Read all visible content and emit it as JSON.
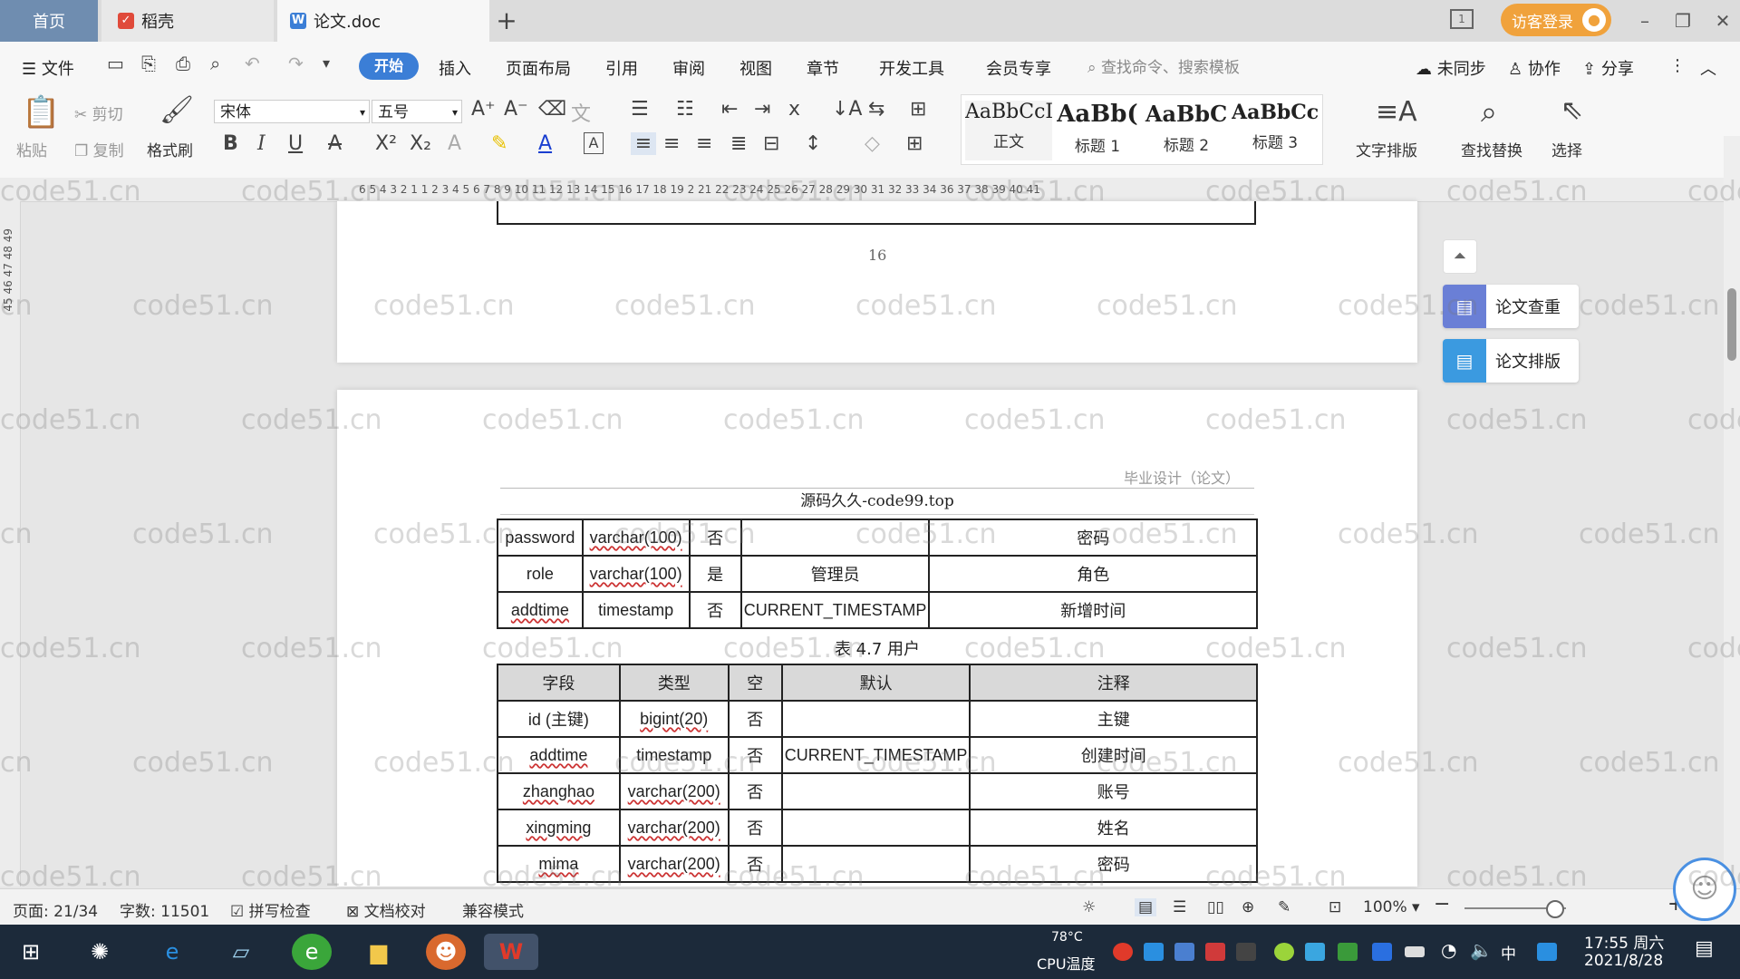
{
  "tabs": {
    "home": "首页",
    "daoke": "稻壳",
    "doc": "论文.doc",
    "visitor_login": "访客登录"
  },
  "menu": {
    "file": "文件",
    "items": [
      "开始",
      "插入",
      "页面布局",
      "引用",
      "审阅",
      "视图",
      "章节",
      "开发工具",
      "会员专享"
    ],
    "search_placeholder": "查找命令、搜索模板",
    "unsynced": "未同步",
    "collaborate": "协作",
    "share": "分享"
  },
  "ribbon": {
    "paste": "粘贴",
    "cut": "剪切",
    "copy": "复制",
    "format_painter": "格式刷",
    "font_name": "宋体",
    "font_size": "五号",
    "styles": [
      {
        "sample": "AaBbCcI",
        "name": "正文"
      },
      {
        "sample": "AaBb(",
        "name": "标题 1"
      },
      {
        "sample": "AaBbC",
        "name": "标题 2"
      },
      {
        "sample": "AaBbCcl",
        "name": "标题 3"
      }
    ],
    "text_layout": "文字排版",
    "find_replace": "查找替换",
    "select": "选择"
  },
  "ruler": {
    "numbers": "6 5 4 3 2 1  1 2 3 4 5 6 7 8 9 10 11 12 13 14 15 16 17 18 19 2 21 22 23 24 25 26 27 28 29 30 31 32 33 34  36 37 38 39 40 41",
    "vertical": "45  46  47  48  49"
  },
  "document": {
    "page_number": "16",
    "header_right": "毕业设计（论文）",
    "header_center": "源码久久-code99.top",
    "table1_rows": [
      [
        "password",
        "varchar(100)",
        "否",
        "",
        "密码"
      ],
      [
        "role",
        "varchar(100)",
        "是",
        "管理员",
        "角色"
      ],
      [
        "addtime",
        "timestamp",
        "否",
        "CURRENT_TIMESTAMP",
        "新增时间"
      ]
    ],
    "caption": "表 4.7 用户",
    "table2_headers": [
      "字段",
      "类型",
      "空",
      "默认",
      "注释"
    ],
    "table2_rows": [
      [
        "id (主键)",
        "bigint(20)",
        "否",
        "",
        "主键"
      ],
      [
        "addtime",
        "timestamp",
        "否",
        "CURRENT_TIMESTAMP",
        "创建时间"
      ],
      [
        "zhanghao",
        "varchar(200)",
        "否",
        "",
        "账号"
      ],
      [
        "xingming",
        "varchar(200)",
        "否",
        "",
        "姓名"
      ],
      [
        "mima",
        "varchar(200)",
        "否",
        "",
        "密码"
      ]
    ]
  },
  "side_panel": {
    "check": "论文查重",
    "layout": "论文排版"
  },
  "status": {
    "page": "页面: 21/34",
    "words": "字数: 11501",
    "spell": "拼写检查",
    "proof": "文档校对",
    "compat": "兼容模式",
    "zoom": "100%"
  },
  "taskbar": {
    "temp": "78°C",
    "cpu": "CPU温度",
    "ime": "中",
    "time": "17:55 周六",
    "date": "2021/8/28"
  },
  "watermark": "code51.cn",
  "colors": {
    "accent": "#3b7ed6",
    "home_tab": "#6f8db0",
    "visitor": "#f0a23c",
    "side_icon": "#6a7fd6",
    "taskbar": "#1c2a3a"
  }
}
